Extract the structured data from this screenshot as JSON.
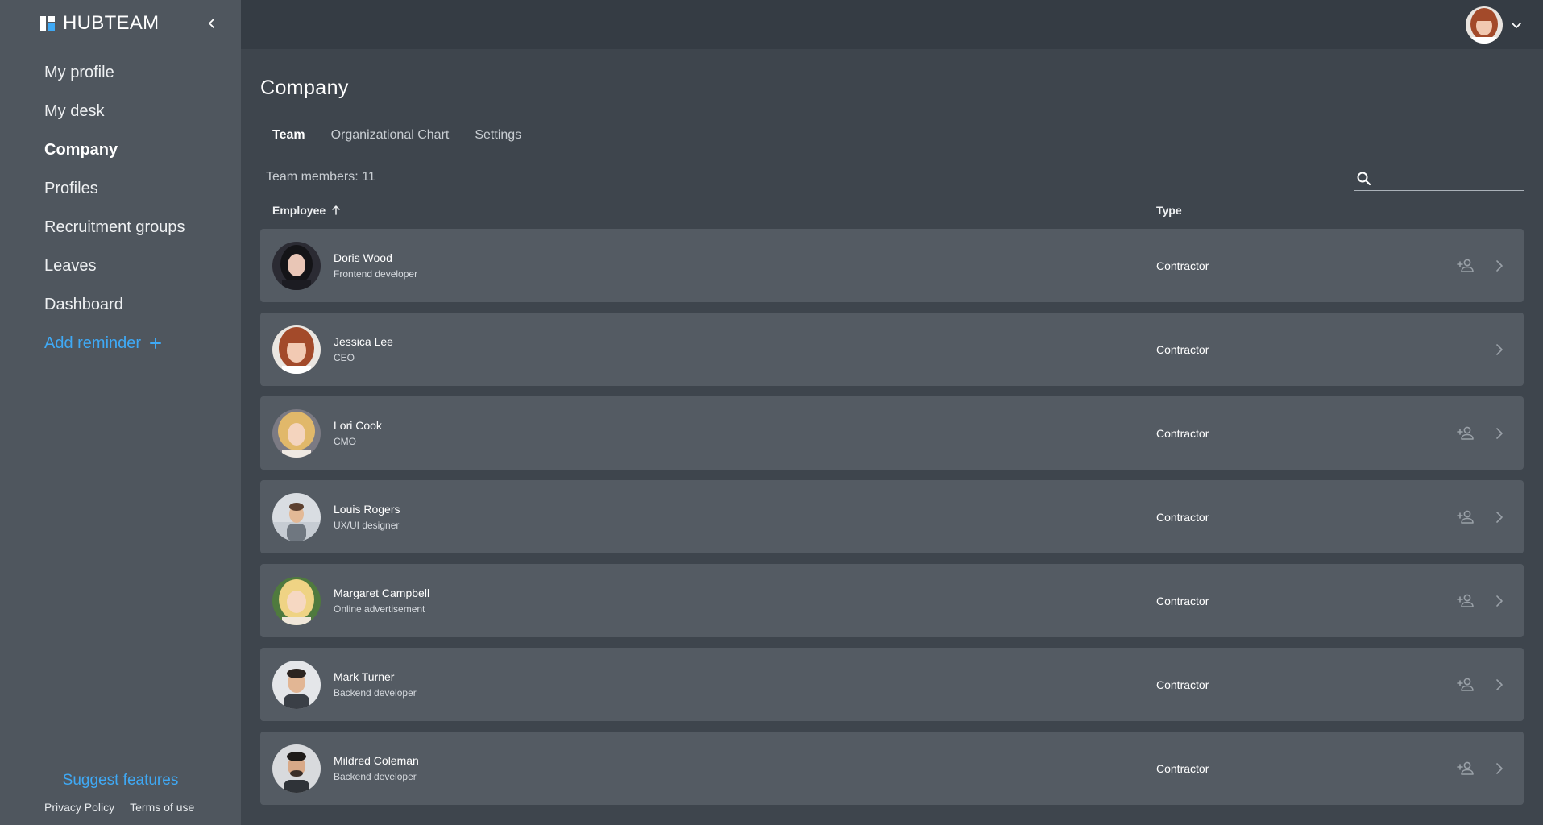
{
  "app": {
    "name": "HUBTEAM"
  },
  "sidebar": {
    "items": [
      {
        "label": "My profile"
      },
      {
        "label": "My desk"
      },
      {
        "label": "Company"
      },
      {
        "label": "Profiles"
      },
      {
        "label": "Recruitment groups"
      },
      {
        "label": "Leaves"
      },
      {
        "label": "Dashboard"
      }
    ],
    "active": "Company",
    "add_reminder": "Add reminder",
    "suggest_features": "Suggest features",
    "privacy_policy": "Privacy Policy",
    "terms_of_use": "Terms of use"
  },
  "page": {
    "title": "Company",
    "tabs": [
      {
        "label": "Team"
      },
      {
        "label": "Organizational Chart"
      },
      {
        "label": "Settings"
      }
    ],
    "members_count": "Team members: 11",
    "search": {
      "placeholder": "",
      "value": ""
    },
    "columns": {
      "employee": "Employee",
      "type": "Type"
    }
  },
  "employees": [
    {
      "name": "Doris Wood",
      "role": "Frontend developer",
      "type": "Contractor",
      "show_add": true
    },
    {
      "name": "Jessica Lee",
      "role": "CEO",
      "type": "Contractor",
      "show_add": false
    },
    {
      "name": "Lori Cook",
      "role": "CMO",
      "type": "Contractor",
      "show_add": true
    },
    {
      "name": "Louis Rogers",
      "role": "UX/UI designer",
      "type": "Contractor",
      "show_add": true
    },
    {
      "name": "Margaret Campbell",
      "role": "Online advertisement",
      "type": "Contractor",
      "show_add": true
    },
    {
      "name": "Mark Turner",
      "role": "Backend developer",
      "type": "Contractor",
      "show_add": true
    },
    {
      "name": "Mildred Coleman",
      "role": "Backend developer",
      "type": "Contractor",
      "show_add": true
    }
  ],
  "colors": {
    "accent": "#3fa9f5",
    "sidebar_bg": "#4f565e",
    "topbar_bg": "#353c44",
    "main_bg": "#3e454d",
    "row_bg": "#545b63"
  },
  "icons": {
    "collapse": "chevron-left-icon",
    "user_menu": "chevron-down-icon",
    "search": "search-icon",
    "sort": "arrow-up-icon",
    "add_person": "person-add-icon",
    "open": "chevron-right-icon"
  }
}
